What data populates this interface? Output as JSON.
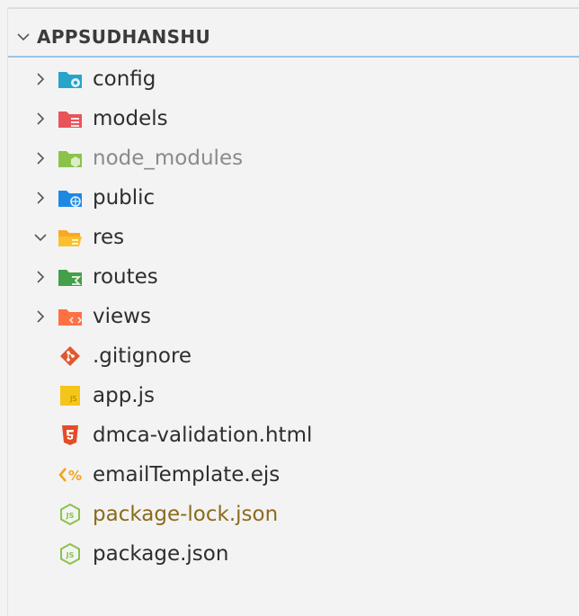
{
  "explorer": {
    "title": "APPSUDHANSHU",
    "expanded": true
  },
  "colors": {
    "accent": "#9cc2ea",
    "config": "#26a5c9",
    "models": "#e9545b",
    "node_modules": "#8bc34a",
    "public": "#1e88e5",
    "res": "#fbc02d",
    "routes": "#43a047",
    "views": "#ff7043",
    "git": "#e0582d",
    "js": "#f5c518",
    "html": "#e44d26",
    "ejs": "#f2a51c",
    "json": "#8bc34a"
  },
  "tree": [
    {
      "label": "config",
      "kind": "folder",
      "expanded": false,
      "icon": "folder-config-icon"
    },
    {
      "label": "models",
      "kind": "folder",
      "expanded": false,
      "icon": "folder-models-icon"
    },
    {
      "label": "node_modules",
      "kind": "folder",
      "expanded": false,
      "icon": "folder-node-icon",
      "ignored": true
    },
    {
      "label": "public",
      "kind": "folder",
      "expanded": false,
      "icon": "folder-public-icon"
    },
    {
      "label": "res",
      "kind": "folder",
      "expanded": true,
      "icon": "folder-open-icon"
    },
    {
      "label": "routes",
      "kind": "folder",
      "expanded": false,
      "icon": "folder-routes-icon"
    },
    {
      "label": "views",
      "kind": "folder",
      "expanded": false,
      "icon": "folder-views-icon"
    },
    {
      "label": ".gitignore",
      "kind": "file",
      "icon": "git-icon"
    },
    {
      "label": "app.js",
      "kind": "file",
      "icon": "js-icon"
    },
    {
      "label": "dmca-validation.html",
      "kind": "file",
      "icon": "html5-icon"
    },
    {
      "label": "emailTemplate.ejs",
      "kind": "file",
      "icon": "ejs-icon"
    },
    {
      "label": "package-lock.json",
      "kind": "file",
      "icon": "nodejs-icon",
      "modified": true
    },
    {
      "label": "package.json",
      "kind": "file",
      "icon": "nodejs-icon"
    }
  ]
}
